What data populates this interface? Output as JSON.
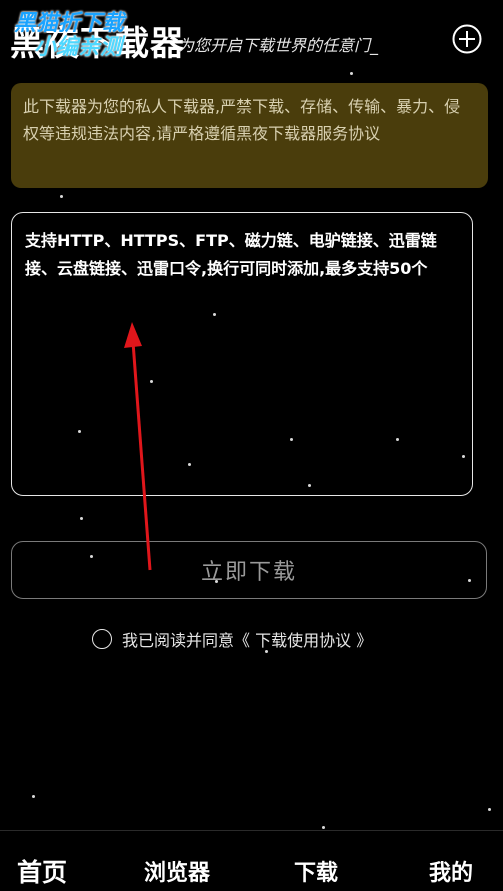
{
  "header": {
    "title": "黑夜下载器",
    "subtitle": "为您开启下载世界的任意门_",
    "watermark_line1": "黑猫折下载",
    "watermark_line2": "小编亲测",
    "add_icon": "plus-circle-icon"
  },
  "notice": {
    "text": "此下载器为您的私人下载器,严禁下载、存储、传输、暴力、侵权等违规违法内容,请严格遵循黑夜下载器服务协议",
    "bg_color": "#4a3d0c"
  },
  "url_input": {
    "placeholder": "支持HTTP、HTTPS、FTP、磁力链、电驴链接、迅雷链接、云盘链接、迅雷口令,换行可同时添加,最多支持50个"
  },
  "download_button": {
    "label": "立即下载"
  },
  "agreement": {
    "text": "我已阅读并同意",
    "link": "《 下载使用协议 》",
    "checked": false
  },
  "tabs": [
    {
      "label": "首页",
      "active": true
    },
    {
      "label": "浏览器",
      "active": false
    },
    {
      "label": "下载",
      "active": false
    },
    {
      "label": "我的",
      "active": false
    }
  ],
  "annotation_arrow_color": "#e0161b"
}
